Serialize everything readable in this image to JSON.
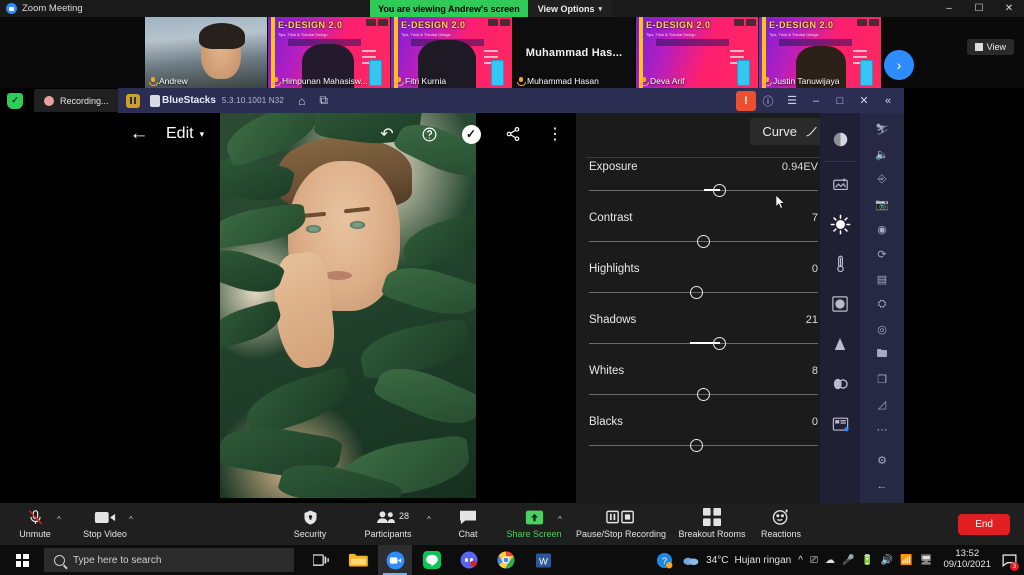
{
  "zoom_window": {
    "title": "Zoom Meeting",
    "sharing_banner": "You are viewing Andrew's screen",
    "view_options_label": "View Options",
    "view_button_label": "View",
    "minimize": "–",
    "restore": "❐",
    "close": "✕",
    "next_arrow": "›"
  },
  "participants": [
    {
      "name": "Andrew",
      "type": "camera",
      "poster_title": ""
    },
    {
      "name": "Himpunan Mahasisw...",
      "type": "poster",
      "poster_title": "E-DESIGN 2.0",
      "poster_sub": "Tips, Trick & Tutorial Design"
    },
    {
      "name": "Fitri Kurnia",
      "type": "poster",
      "poster_title": "E-DESIGN 2.0",
      "poster_sub": "Tips, Trick & Tutorial Design"
    },
    {
      "name": "Muhammad Hasan",
      "type": "name-only",
      "big_name": "Muhammad  Has...",
      "poster_title": ""
    },
    {
      "name": "Deva Arif",
      "type": "poster",
      "poster_title": "E-DESIGN 2.0",
      "poster_sub": "Tips, Trick & Tutorial Design"
    },
    {
      "name": "Justin Tanuwijaya",
      "type": "poster",
      "poster_title": "E-DESIGN 2.0",
      "poster_sub": "Tips, Trick & Tutorial Design"
    }
  ],
  "recording": {
    "status_text": "Recording...",
    "shield_glyph": "✓"
  },
  "bluestacks": {
    "app_name": "BlueStacks",
    "version": "5.3.10.1001 N32",
    "home_icon": "⌂",
    "tabs_icon": "⧉",
    "alert_glyph": "!",
    "help_glyph": "?",
    "menu_glyph": "☰",
    "minimize_glyph": "–",
    "maximize_glyph": "□",
    "close_glyph": "✕",
    "collapse_glyph": "«",
    "sidebar_icons": [
      "fullscreen-icon",
      "volume-icon",
      "keymapping-icon",
      "screenshot-icon",
      "record-icon",
      "rotate-icon",
      "multi-instance-icon",
      "macro-icon",
      "location-icon",
      "media-folder-icon",
      "copy-icon",
      "shake-icon",
      "more-icon",
      "settings-icon",
      "back-icon"
    ]
  },
  "photo_editor": {
    "back_glyph": "←",
    "title": "Edit",
    "title_caret": "▾",
    "undo_glyph": "↶",
    "help_glyph": "?",
    "confirm_glyph": "✓",
    "share_glyph": "≪",
    "more_glyph": "⋮",
    "curve_label": "Curve",
    "tool_rail": [
      "tone-icon",
      "image-adjust-icon",
      "brightness-icon",
      "temperature-icon",
      "vignette-icon",
      "sharpen-icon",
      "blur-icon",
      "effects-icon"
    ],
    "active_tool": "brightness-icon",
    "sliders": [
      {
        "label": "Exposure",
        "value": "0.94EV",
        "knob_pct": 57,
        "fill_from_pct": 50
      },
      {
        "label": "Contrast",
        "value": "7",
        "knob_pct": 50,
        "fill_from_pct": 50
      },
      {
        "label": "Highlights",
        "value": "0",
        "knob_pct": 47,
        "fill_from_pct": 47
      },
      {
        "label": "Shadows",
        "value": "21",
        "knob_pct": 57,
        "fill_from_pct": 44
      },
      {
        "label": "Whites",
        "value": "8",
        "knob_pct": 50,
        "fill_from_pct": 50
      },
      {
        "label": "Blacks",
        "value": "0",
        "knob_pct": 47,
        "fill_from_pct": 47
      }
    ]
  },
  "zoom_controls": {
    "unmute": {
      "label": "Unmute",
      "icon": "mic-muted-icon"
    },
    "stop_video": {
      "label": "Stop Video",
      "icon": "video-icon"
    },
    "security": {
      "label": "Security",
      "icon": "shield-icon"
    },
    "participants": {
      "label": "Participants",
      "icon": "people-icon",
      "count": "28"
    },
    "chat": {
      "label": "Chat",
      "icon": "chat-bubble-icon"
    },
    "share_screen": {
      "label": "Share Screen",
      "icon": "share-screen-icon"
    },
    "recording": {
      "label": "Pause/Stop Recording",
      "icon": "pause-stop-icon"
    },
    "breakout": {
      "label": "Breakout Rooms",
      "icon": "grid-icon"
    },
    "reactions": {
      "label": "Reactions",
      "icon": "smiley-icon"
    },
    "end": {
      "label": "End"
    },
    "caret": "^"
  },
  "taskbar": {
    "search_placeholder": "Type here to search",
    "weather_temp": "34°C",
    "weather_desc": "Hujan ringan",
    "time": "13:52",
    "date": "09/10/2021",
    "notification_count": "3",
    "tray_caret": "^",
    "icons": [
      "task-view-icon",
      "file-explorer-icon",
      "zoom-icon",
      "line-icon",
      "discord-icon",
      "chrome-icon",
      "word-icon"
    ],
    "tray_icons": [
      "meet-now-icon",
      "onedrive-icon",
      "mic-icon",
      "battery-icon",
      "volume-icon",
      "network-icon",
      "display-icon"
    ]
  },
  "colors": {
    "zoom_green": "#2ecc57",
    "zoom_blue": "#2d8cff",
    "end_red": "#e02020",
    "bluestacks_purple": "#2b2d52",
    "panel_bg": "#1b1b1b"
  }
}
